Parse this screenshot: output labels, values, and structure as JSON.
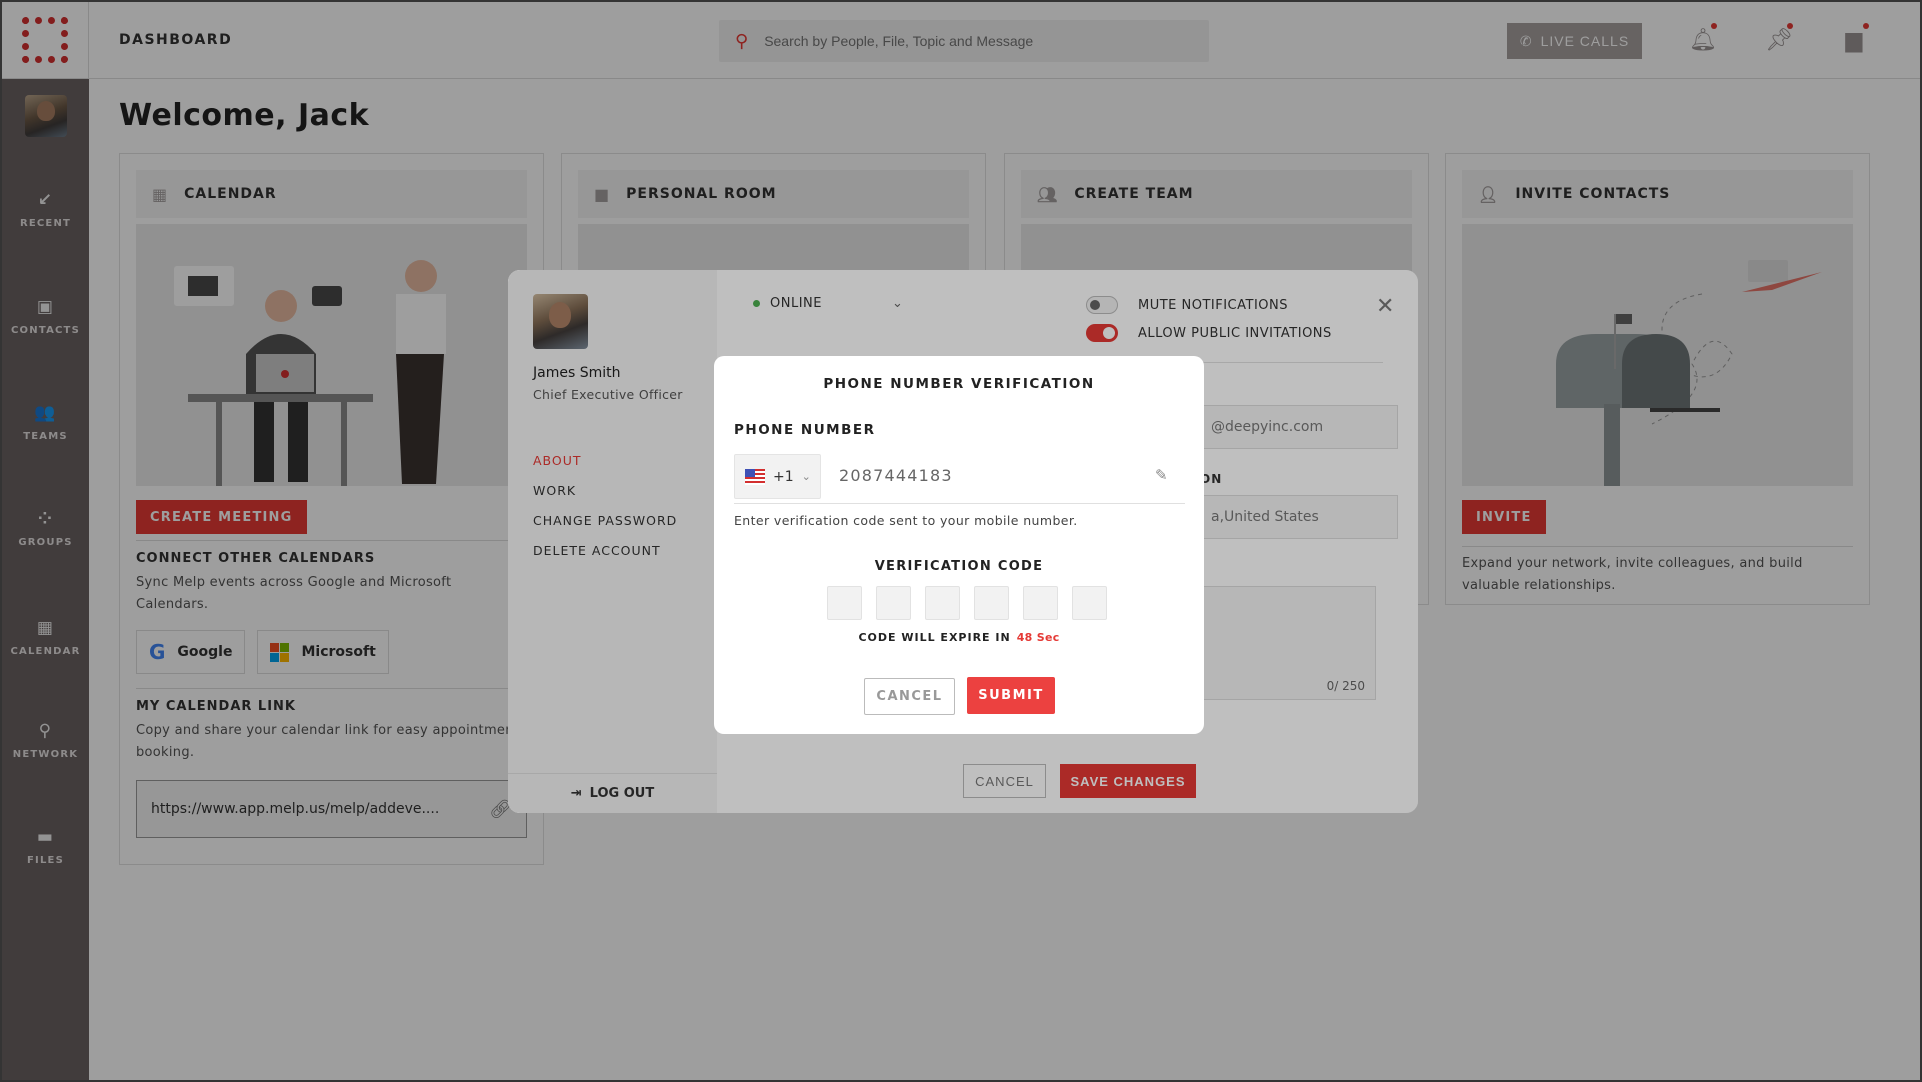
{
  "app": {
    "logo": "melp-logo",
    "page_title": "DASHBOARD"
  },
  "header": {
    "search_placeholder": "Search by People, File, Topic and Message",
    "live_calls_label": "LIVE CALLS",
    "icons": [
      "bell-icon",
      "pin-icon",
      "chat-icon"
    ]
  },
  "rail": {
    "items": [
      {
        "label": "RECENT",
        "icon": "↙"
      },
      {
        "label": "CONTACTS",
        "icon": "▣"
      },
      {
        "label": "TEAMS",
        "icon": "👥"
      },
      {
        "label": "GROUPS",
        "icon": "⁘"
      },
      {
        "label": "CALENDAR",
        "icon": "▦"
      },
      {
        "label": "NETWORK",
        "icon": "⚲"
      },
      {
        "label": "FILES",
        "icon": "▬"
      }
    ]
  },
  "welcome": "Welcome, Jack",
  "cards": {
    "calendar": {
      "title": "CALENDAR",
      "button": "CREATE MEETING",
      "connect_title": "CONNECT OTHER CALENDARS",
      "connect_text": "Sync Melp events across Google and Microsoft Calendars.",
      "google_label": "Google",
      "microsoft_label": "Microsoft",
      "link_title": "MY CALENDAR LINK",
      "link_text": "Copy and share your calendar link for easy appointment booking.",
      "link_value": "https://www.app.melp.us/melp/addeve...."
    },
    "personal_room": {
      "title": "PERSONAL ROOM"
    },
    "create_team": {
      "title": "CREATE TEAM"
    },
    "invite": {
      "title": "INVITE CONTACTS",
      "button": "INVITE",
      "text": "Expand your network, invite colleagues, and build valuable relationships."
    }
  },
  "profile": {
    "name": "James Smith",
    "role": "Chief Executive Officer",
    "menu": [
      "ABOUT",
      "WORK",
      "CHANGE PASSWORD",
      "DELETE ACCOUNT"
    ],
    "active_menu": "ABOUT",
    "logout": "LOG OUT",
    "status": "ONLINE",
    "mute_notifications": {
      "label": "MUTE NOTIFICATIONS",
      "on": false
    },
    "public_invitations": {
      "label": "ALLOW PUBLIC INVITATIONS",
      "on": true
    },
    "email_partial": "@deepyinc.com",
    "location_label_partial": "ON",
    "location_partial": "a,United States",
    "bio_count": "0/ 250",
    "cancel": "CANCEL",
    "save": "SAVE CHANGES"
  },
  "verify": {
    "title": "PHONE NUMBER VERIFICATION",
    "phone_label": "PHONE NUMBER",
    "country_code": "+1",
    "country_flag": "US",
    "phone": "2087444183",
    "hint": "Enter verification code sent to your mobile number.",
    "code_label": "VERIFICATION CODE",
    "code_digits": [
      "",
      "",
      "",
      "",
      "",
      ""
    ],
    "expire_label": "CODE WILL EXPIRE IN",
    "expire_value": "48 Sec",
    "cancel": "CANCEL",
    "submit": "SUBMIT"
  },
  "colors": {
    "accent": "#e53935",
    "rail": "#6a6161",
    "online": "#4caf50"
  }
}
